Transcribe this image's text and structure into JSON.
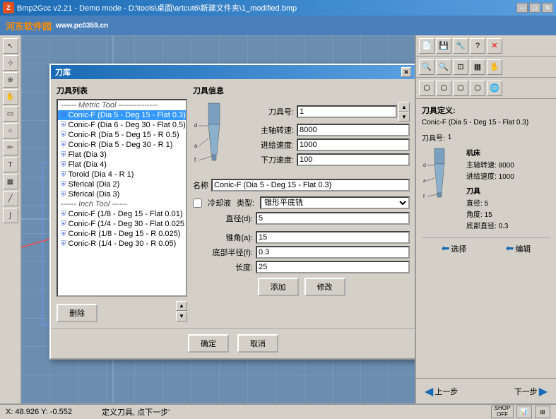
{
  "titleBar": {
    "text": "Bmp2Gcc v2.21 - Demo mode - D:\\tools\\桌面\\artcut6\\新建文件夹\\1_modified.bmp",
    "buttons": [
      "─",
      "□",
      "✕"
    ]
  },
  "watermark": {
    "logo": "河东软件园",
    "url": "www.pc0359.cn"
  },
  "dialog": {
    "title": "刀库",
    "closeLabel": "✕",
    "listLabel": "刀具列表",
    "infoLabel": "刀具信息",
    "listItems": [
      {
        "type": "header",
        "text": "------ Metric Tool ---------------"
      },
      {
        "type": "tool",
        "text": "Conic-F (Dia 5 - Deg 15 - Flat 0.3)",
        "selected": true
      },
      {
        "type": "tool",
        "text": "Conic-F (Dia 6 - Deg 30 - Flat 0.5)"
      },
      {
        "type": "tool",
        "text": "Conic-R (Dia 5 - Deg 15 - R 0.5)"
      },
      {
        "type": "tool",
        "text": "Conic-R (Dia 5 - Deg 30 - R 1)"
      },
      {
        "type": "tool",
        "text": "Flat (Dia 3)"
      },
      {
        "type": "tool",
        "text": "Flat (Dia 4)"
      },
      {
        "type": "tool",
        "text": "Toroid (Dia 4 - R 1)"
      },
      {
        "type": "tool",
        "text": "Sferical (Dia 2)"
      },
      {
        "type": "tool",
        "text": "Sferical (Dia 3)"
      },
      {
        "type": "header",
        "text": "------ Inch Tool ------"
      },
      {
        "type": "tool",
        "text": "Conic-F (1/8 - Deg 15 - Flat 0.01)"
      },
      {
        "type": "tool",
        "text": "Conic-F (1/4 - Deg 30 - Flat 0.025"
      },
      {
        "type": "tool",
        "text": "Conic-R (1/8 - Deg 15 - R 0.025)"
      },
      {
        "type": "tool",
        "text": "Conic-R (1/4 - Deg 30 - R 0.05)"
      }
    ],
    "deleteLabel": "删除",
    "fields": {
      "toolNumLabel": "刀具号:",
      "toolNum": "1",
      "spindleLabel": "主轴转速:",
      "spindle": "8000",
      "feedLabel": "进给速度:",
      "feed": "1000",
      "plungeLabel": "下刀速度:",
      "plunge": "100",
      "nameLabel": "名称",
      "nameValue": "Conic-F (Dia 5 - Deg 15 - Flat 0.3)",
      "coolantLabel": "冷却液",
      "typeLabel": "类型:",
      "typeValue": "锥形平底铣",
      "diamLabel": "直径(d):",
      "diamValue": "5",
      "coneLabel": "锥角(a):",
      "coneValue": "15",
      "flatRadLabel": "底部半径(f):",
      "flatRadValue": "0.3",
      "lengthLabel": "长度:",
      "lengthValue": "25"
    },
    "addLabel": "添加",
    "modifyLabel": "修改",
    "okLabel": "确定",
    "cancelLabel": "取消"
  },
  "rightPanel": {
    "toolDef": {
      "title": "刀具定义:",
      "name": "Conic-F (Dia 5 - Deg 15 - Flat 0.3)",
      "numLabel": "刀具号:",
      "numValue": "1",
      "machineLabel": "机床",
      "spindleLabel": "主轴转速:",
      "spindleValue": "8000",
      "feedLabel": "进给速度:",
      "feedValue": "1000",
      "toolLabel": "刀具",
      "diamLabel": "直径:",
      "diamValue": "5",
      "angleLabel": "角度:",
      "angleValue": "15",
      "flatDiamLabel": "底部直径:",
      "flatDiamValue": "0.3",
      "dLabel": "d",
      "aLabel": "a",
      "fLabel": "f"
    },
    "selectLabel": "选择",
    "editLabel": "编辑",
    "prevLabel": "上一步",
    "nextLabel": "下一步"
  },
  "statusBar": {
    "coords": "X: 48.926 Y: -0.552",
    "message": "定义刀具, 点下一步'",
    "shopLabel": "SHOP\nOFF"
  }
}
